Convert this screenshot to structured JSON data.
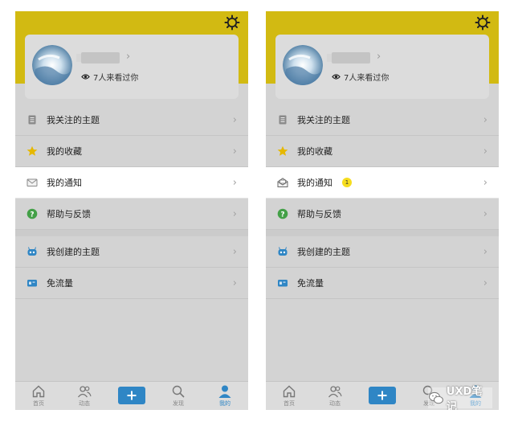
{
  "screens": [
    {
      "profile": {
        "visitors_text": "7人来看过你"
      },
      "menu": [
        {
          "label": "我关注的主题",
          "icon": "topics-icon"
        },
        {
          "label": "我的收藏",
          "icon": "star-icon"
        },
        {
          "label": "我的通知",
          "icon": "mail-icon",
          "active": true
        },
        {
          "label": "帮助与反馈",
          "icon": "help-icon"
        },
        {
          "label": "我创建的主题",
          "icon": "robot-icon"
        },
        {
          "label": "免流量",
          "icon": "sim-card-icon"
        }
      ],
      "notification_badge": "",
      "tabs": [
        {
          "label": "首页"
        },
        {
          "label": "动态"
        },
        {
          "label": "发现"
        },
        {
          "label": "我的"
        }
      ]
    },
    {
      "profile": {
        "visitors_text": "7人来看过你"
      },
      "menu": [
        {
          "label": "我关注的主题",
          "icon": "topics-icon"
        },
        {
          "label": "我的收藏",
          "icon": "star-icon"
        },
        {
          "label": "我的通知",
          "icon": "envelope-open-icon",
          "active": true
        },
        {
          "label": "帮助与反馈",
          "icon": "help-icon"
        },
        {
          "label": "我创建的主题",
          "icon": "robot-icon"
        },
        {
          "label": "免流量",
          "icon": "sim-card-icon"
        }
      ],
      "notification_badge": "1",
      "tabs": [
        {
          "label": "首页"
        },
        {
          "label": "动态"
        },
        {
          "label": "发现"
        },
        {
          "label": "我的"
        }
      ]
    }
  ],
  "watermark": {
    "text": "UXD笔记"
  },
  "colors": {
    "header_yellow": "#d2ba12",
    "accent_blue": "#2f86c5",
    "badge_yellow": "#f6dd1e",
    "star_gold": "#e6b800",
    "help_green": "#43a047"
  }
}
